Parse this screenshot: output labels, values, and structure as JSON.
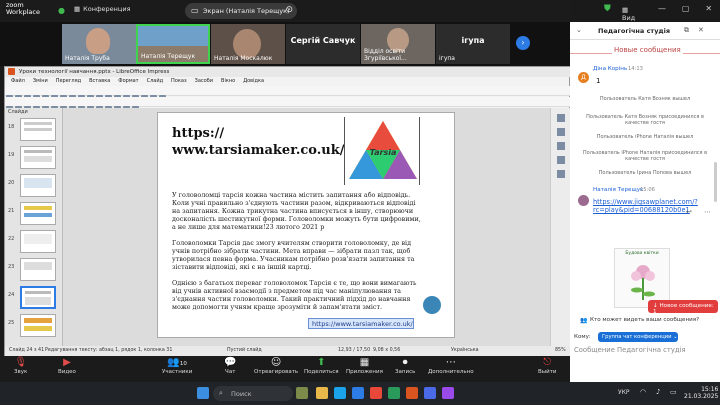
{
  "topbar": {
    "logo_line1": "zoom",
    "logo_line2": "Workplace",
    "conference_label": "Конференция",
    "share_label": "Экран (Наталія Терещук)",
    "video_label": "Вид"
  },
  "gallery": {
    "tiles": [
      {
        "name": "Наталія Труба"
      },
      {
        "name": "Наталія Терещук"
      },
      {
        "name": "Наталія Москалюк"
      },
      {
        "name": "Сергій Савчук",
        "big": "Сергій Савчук"
      },
      {
        "name": "Відділ освіти Згуріївської..."
      },
      {
        "name": "ігупа",
        "big": "ігупа"
      }
    ]
  },
  "impress": {
    "title": "Уроки технології навчання.pptx - LibreOffice Impress",
    "menu": [
      "Файл",
      "Зміни",
      "Перегляд",
      "Вставка",
      "Формат",
      "Слайд",
      "Показ",
      "Засоби",
      "Вікно",
      "Довідка"
    ],
    "slides_label": "Слайди",
    "slide_numbers": [
      "18",
      "19",
      "20",
      "21",
      "22",
      "23",
      "24",
      "25"
    ],
    "status": {
      "slide": "Слайд 24 з 41",
      "edit": "Редагування тексту: абзац 1, рядок 1, колонка 31",
      "layout": "Пустий слайд",
      "pos": "12,93 / 17,50",
      "size": "9,08 x 0,56",
      "lang": "Українська",
      "zoom": "85%"
    }
  },
  "slide": {
    "url_title": "https:// www.tarsiamaker.co.uk/",
    "logo_text": "Tarsia",
    "para1": "У головоломці тарсія кожна частина містить запитання або відповідь. Коли учні правильно з'єднують частини разом, відкриваються відповіді на запитання. Кожна трикутна частина вписується в іншу, створюючи досконалість шестикутної форми. Головоломки можуть бути цифровими, а не лише для математики!23 лютого 2021 р",
    "para2": "Головоломки Тарсія дає змогу вчителям створити головоломку, де від учнів потрібно зібрати частини. Мета вправи — зібрати пазл так, щоб утворилася певна форма. Учасникам потрібно розв'язати запитання та зіставити відповіді, які є на іншій картці.",
    "para3": "Однією з багатьох переваг головоломок Тарсія є те, що вони вимагають від учнів активної взаємодії з предметом під час маніпулювання та з'єднання частин головоломки. Такий практичний підхід до навчання може допомогти учням краще зрозуміти й запам'ятати зміст.",
    "link_box": "https://www.tarsiamaker.co.uk/"
  },
  "chat": {
    "title": "Педагогічна студія",
    "new_messages": "Новые сообщения",
    "sender1_name": "Діна Корінь",
    "sender1_time": "14:13",
    "sender1_msg": "1",
    "sender1_initial": "Д",
    "system_msgs": [
      "Пользователь Катя Возняк вышел",
      "Пользователь Катя Возняк присоединился в качестве гостя",
      "Пользователь iPhone Наталія вышел",
      "Пользователь iPhone Наталія присоединился в качестве гостя",
      "Пользователь Ірина Попова вышел"
    ],
    "sender2_name": "Наталія Терещук",
    "sender2_time": "15:06",
    "link_msg": "https://www.jigsawplanet.com/?rc=play&pid=00688120b0e1",
    "preview_title": "Будова квітки",
    "new_message_btn": "↓ Новое сообщение: 1",
    "who_read": "Кто может видеть ваши сообщения?",
    "to_label": "Кому:",
    "to_value": "Группа чат конференции",
    "input_placeholder": "Сообщение Педагогічна студія"
  },
  "bottombar": {
    "buttons": [
      {
        "label": "Звук",
        "icon": "microphone-icon"
      },
      {
        "label": "Видео",
        "icon": "video-icon"
      },
      {
        "label": "Участники",
        "icon": "participants-icon",
        "badge": "10"
      },
      {
        "label": "Чат",
        "icon": "chat-icon"
      },
      {
        "label": "Отреагировать",
        "icon": "react-icon"
      },
      {
        "label": "Поделиться",
        "icon": "share-icon"
      },
      {
        "label": "Приложения",
        "icon": "apps-icon"
      },
      {
        "label": "Запись",
        "icon": "record-icon"
      },
      {
        "label": "Дополнительно",
        "icon": "more-icon"
      },
      {
        "label": "Выйти",
        "icon": "leave-icon"
      }
    ]
  },
  "taskbar": {
    "search": "Поиск",
    "lang": "УКР",
    "time": "15:16",
    "date": "21.03.2025"
  },
  "colors": {
    "accent": "#1a6fd6",
    "leave": "#e23d3d",
    "new_messages": "#b44444"
  }
}
